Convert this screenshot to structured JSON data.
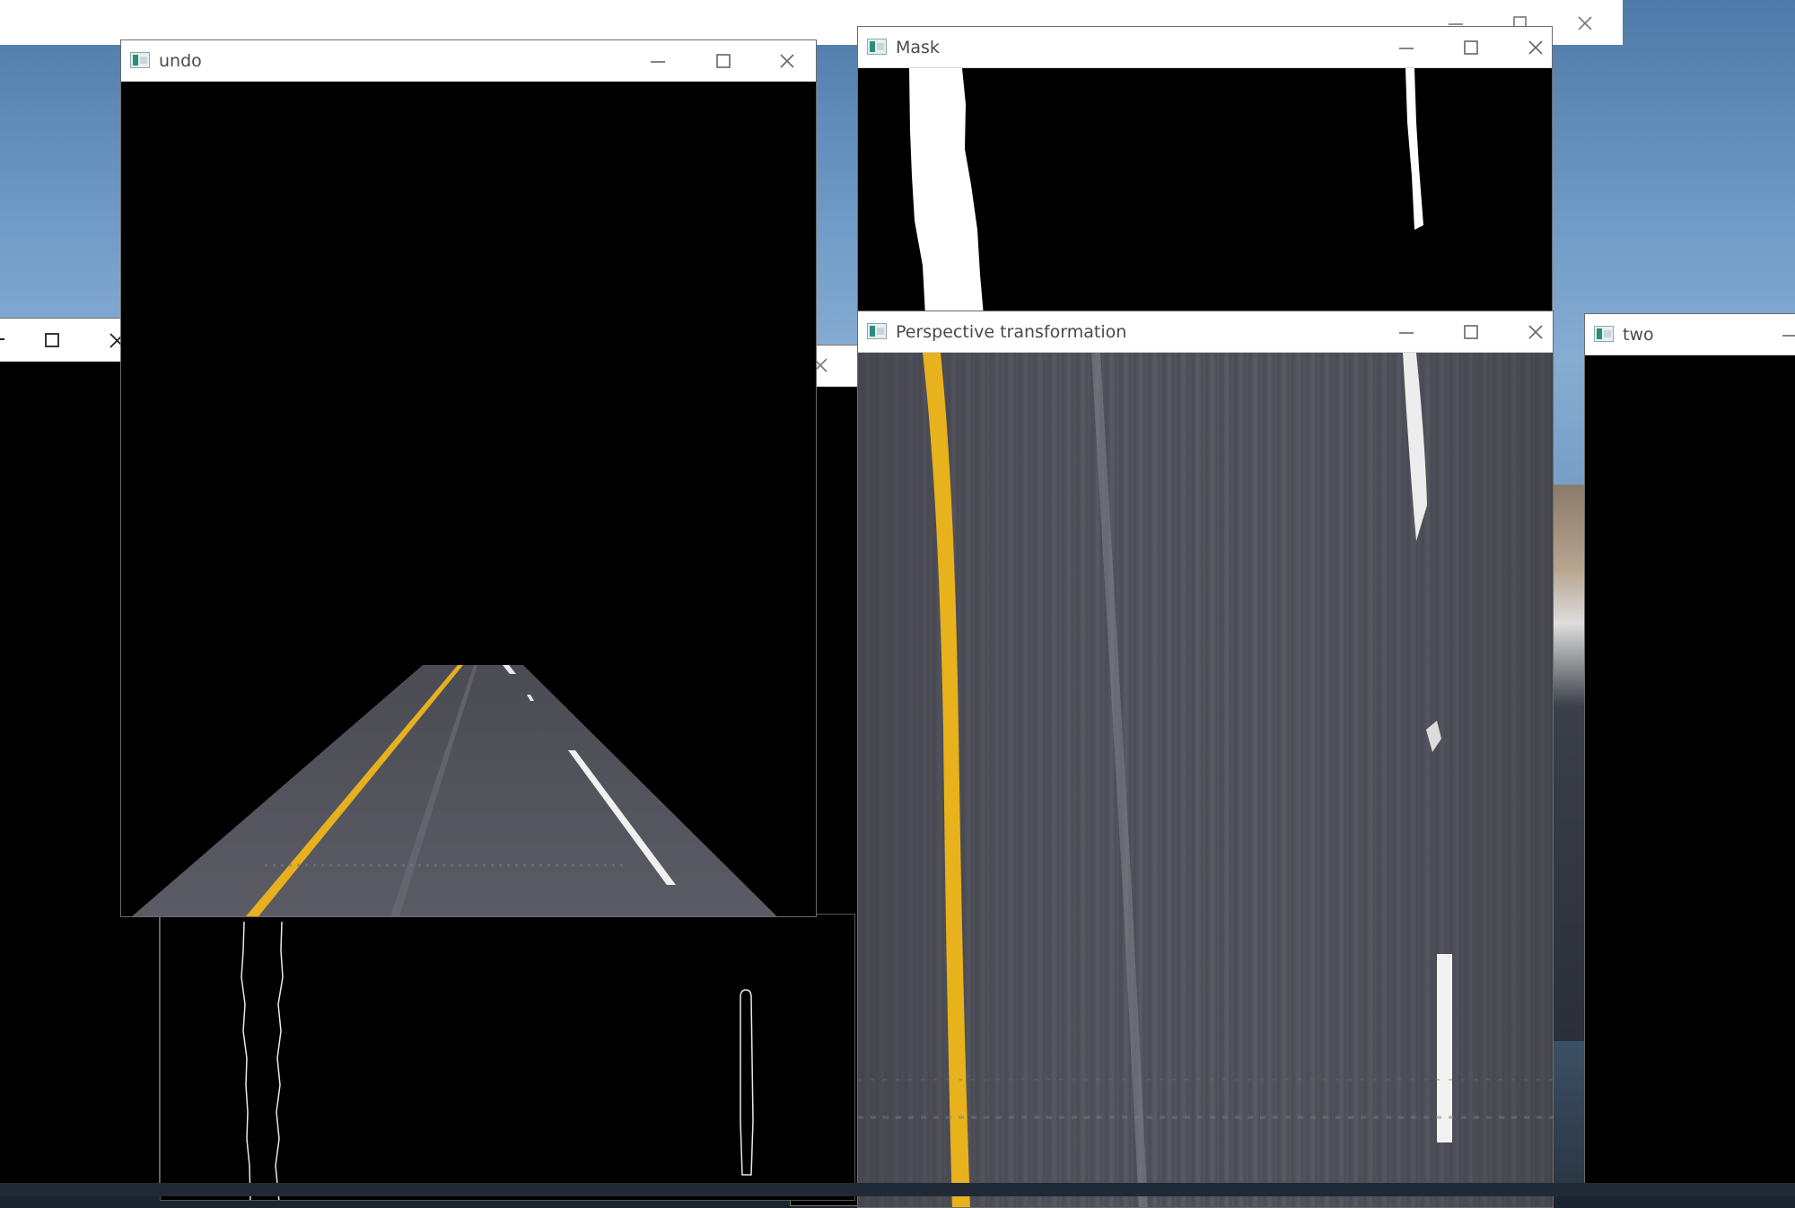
{
  "windows": {
    "background_window": {
      "title": ""
    },
    "left_window": {
      "title": ""
    },
    "undo": {
      "title": "undo"
    },
    "mask": {
      "title": "Mask"
    },
    "perspective": {
      "title": "Perspective transformation"
    },
    "two": {
      "title": "two"
    }
  },
  "colors": {
    "titlebar": "#ffffff",
    "title_text": "#4a4a4a",
    "lane_yellow": "#e7b21c",
    "lane_white": "#f2f2f2",
    "asphalt": "#55565f"
  },
  "icons": {
    "minimize": "minimize-icon",
    "maximize": "maximize-icon",
    "close": "close-icon",
    "app": "app-icon"
  }
}
